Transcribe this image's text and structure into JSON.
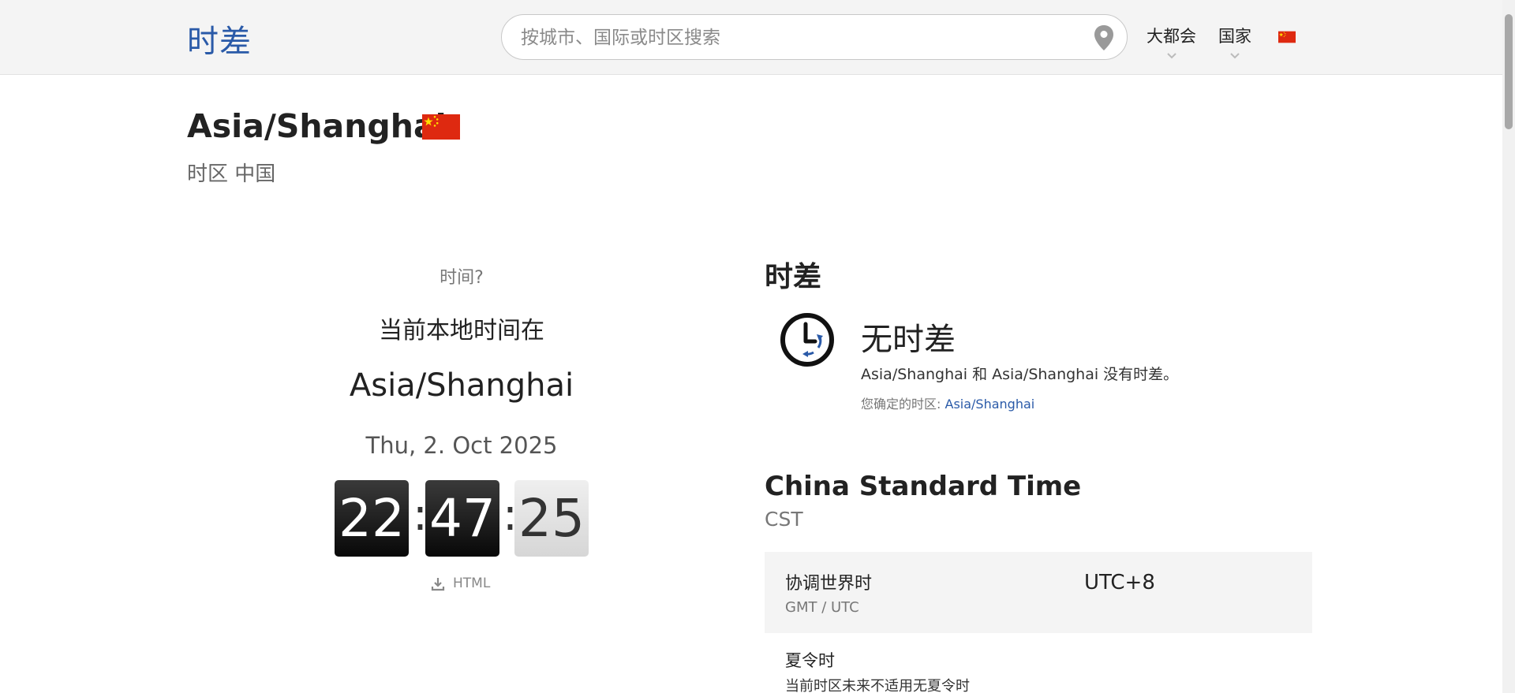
{
  "header": {
    "logo": "时差",
    "search_placeholder": "按城市、国际或时区搜索",
    "nav": [
      "大都会",
      "国家"
    ]
  },
  "page": {
    "title": "Asia/Shanghai",
    "subtitle": "时区 中国"
  },
  "clock_panel": {
    "question": "时间?",
    "current_label": "当前本地时间在",
    "zone": "Asia/Shanghai",
    "date": "Thu, 2. Oct 2025",
    "hours": "22",
    "minutes": "47",
    "seconds": "25",
    "separator": ":",
    "download_label": "HTML"
  },
  "difference": {
    "heading": "时差",
    "result": "无时差",
    "description": "Asia/Shanghai 和 Asia/Shanghai 没有时差。",
    "confirm_label": "您确定的时区:",
    "confirm_link": "Asia/Shanghai"
  },
  "timezone_info": {
    "name": "China Standard Time",
    "abbr": "CST",
    "utc_label": "协调世界时",
    "utc_sub": "GMT / UTC",
    "utc_value": "UTC+8",
    "dst_label": "夏令时",
    "dst_desc": "当前时区未来不适用无夏令时"
  },
  "colors": {
    "accent": "#2a5aa8",
    "flag_red": "#de2910",
    "flag_yellow": "#ffde00"
  }
}
